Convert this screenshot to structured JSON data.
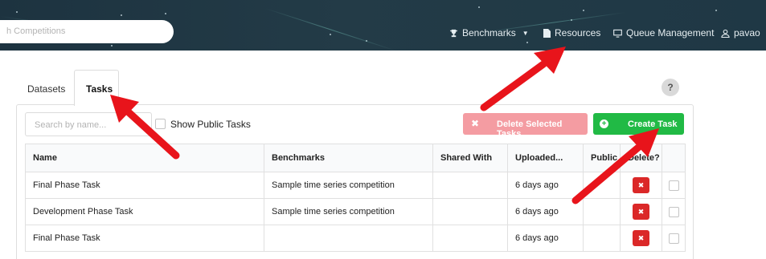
{
  "topbar": {
    "search_placeholder": "h Competitions",
    "nav": {
      "benchmarks": "Benchmarks",
      "resources": "Resources",
      "queue": "Queue Management",
      "user": "pavao"
    }
  },
  "tabs": [
    {
      "label": "Datasets",
      "active": false
    },
    {
      "label": "Tasks",
      "active": true
    }
  ],
  "help_label": "?",
  "toolbar": {
    "search_placeholder": "Search by name...",
    "show_public_label": "Show Public Tasks",
    "show_public_checked": false,
    "delete_selected_label": "Delete Selected Tasks",
    "create_label": "Create Task"
  },
  "table": {
    "columns": [
      "Name",
      "Benchmarks",
      "Shared With",
      "Uploaded...",
      "Public",
      "Delete?",
      ""
    ],
    "rows": [
      {
        "name": "Final Phase Task",
        "benchmarks": "Sample time series competition",
        "shared_with": "",
        "uploaded": "6 days ago",
        "public": ""
      },
      {
        "name": "Development Phase Task",
        "benchmarks": "Sample time series competition",
        "shared_with": "",
        "uploaded": "6 days ago",
        "public": ""
      },
      {
        "name": "Final Phase Task",
        "benchmarks": "",
        "shared_with": "",
        "uploaded": "6 days ago",
        "public": ""
      }
    ]
  },
  "colors": {
    "topbar": "#233b47",
    "delete_selected": "#f49ca2",
    "create": "#21ba45",
    "row_delete": "#db2828",
    "annotation_arrow": "#e8141b"
  },
  "icons": {
    "benchmarks": "trophy-icon",
    "resources": "file-icon",
    "queue": "monitor-icon",
    "user": "user-icon",
    "delete_selected": "close-icon",
    "create": "plus-circle-icon",
    "row_delete": "close-icon"
  }
}
